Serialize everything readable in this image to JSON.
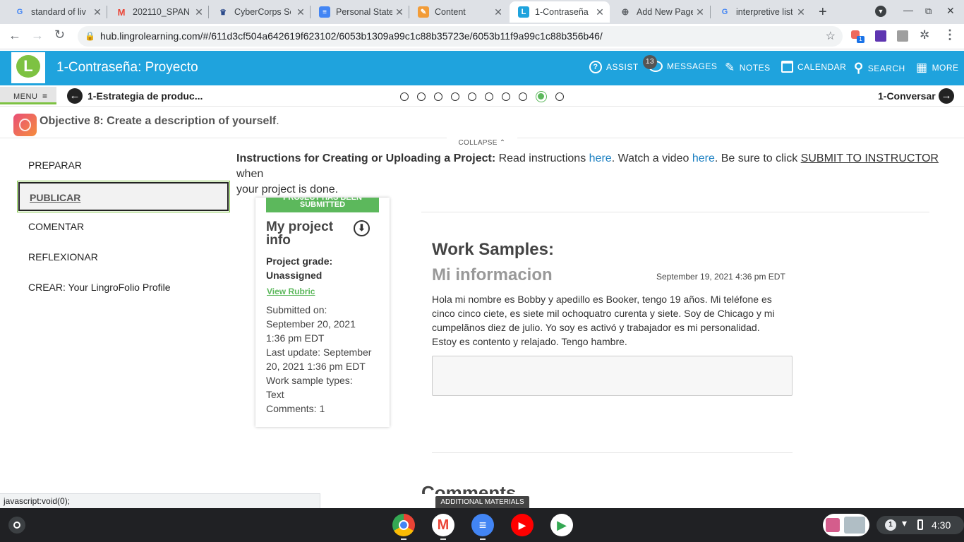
{
  "browser": {
    "tabs": [
      {
        "label": "standard of liv",
        "icon": "google-icon"
      },
      {
        "label": "202110_SPAN",
        "icon": "gmail-icon"
      },
      {
        "label": "CyberCorps Sc",
        "icon": "cybercorps-icon"
      },
      {
        "label": "Personal State",
        "icon": "docs-icon"
      },
      {
        "label": "Content",
        "icon": "content-icon"
      },
      {
        "label": "1-Contraseña",
        "icon": "lingro-icon"
      },
      {
        "label": "Add New Page",
        "icon": "globe-icon"
      },
      {
        "label": "interpretive list",
        "icon": "google-icon"
      }
    ],
    "url": "hub.lingrolearning.com/#/611d3cf504a642619f623102/6053b1309a99c1c88b35723e/6053b11f9a99c1c88b356b46/",
    "extension_badge": "1"
  },
  "app": {
    "title": "1-Contraseña: Proyecto",
    "nav": {
      "assist": "ASSIST",
      "messages": "MESSAGES",
      "messages_count": "13",
      "notes": "NOTES",
      "calendar": "CALENDAR",
      "search": "SEARCH",
      "more": "MORE"
    },
    "menu_label": "MENU",
    "prev_label": "1-Estrategia de produc...",
    "next_label": "1-Conversar",
    "steps_total": 10,
    "steps_active_index": 8,
    "objective_bold": "Objective 8: Create a description of yourself",
    "objective_end": ".",
    "collapse_label": "COLLAPSE"
  },
  "sidebar": {
    "items": [
      {
        "label": "PREPARAR"
      },
      {
        "label": "PUBLICAR"
      },
      {
        "label": "COMENTAR"
      },
      {
        "label": "REFLEXIONAR"
      },
      {
        "label": "CREAR: Your LingroFolio Profile"
      }
    ],
    "active_index": 1
  },
  "instructions": {
    "bold": "Instructions for Creating or Uploading a Project:",
    "t1": " Read instructions ",
    "link1": "here",
    "t2": ". Watch a video ",
    "link2": "here",
    "t3": ". Be sure to click ",
    "submit": "SUBMIT TO INSTRUCTOR",
    "t4": " when",
    "line2": "your project is done."
  },
  "card": {
    "banner": "PROJECT HAS BEEN SUBMITTED",
    "heading": "My project info",
    "grade_label": "Project grade:",
    "grade_value": "Unassigned",
    "rubric_link": "View Rubric",
    "submitted_label": "Submitted on:",
    "submitted_date": "September 20, 2021",
    "submitted_time": "1:36 pm EDT",
    "last_update": "Last update: September",
    "last_update2": "20, 2021 1:36 pm EDT",
    "types_label": "Work sample types:",
    "types_value": "Text",
    "comments": "Comments: 1"
  },
  "work": {
    "heading": "Work Samples:",
    "title": "Mi informacion",
    "date": "September 19, 2021 4:36 pm EDT",
    "lines": [
      "Hola mi nombre es Bobby y apedillo es Booker, tengo 19 años. Mi teléfone es",
      "cinco cinco ciete, es siete mil ochoquatro curenta y siete. Soy de Chicago y mi",
      "cumpelãnos diez de julio. Yo soy es activó y trabajador es mi personalidad.",
      "Estoy es contento y relajado. Tengo hambre."
    ],
    "comments_heading": "Comments",
    "additional_materials": "ADDITIONAL MATERIALS"
  },
  "status_url": "javascript:void(0);",
  "taskbar": {
    "notif_count": "1",
    "time": "4:30",
    "apps": [
      "chrome-icon",
      "gmail-icon",
      "docs-icon",
      "youtube-icon",
      "play-store-icon"
    ]
  },
  "colors": {
    "brand_blue": "#1fa3dd",
    "green": "#5cb85c",
    "link": "#1a7fc1"
  }
}
